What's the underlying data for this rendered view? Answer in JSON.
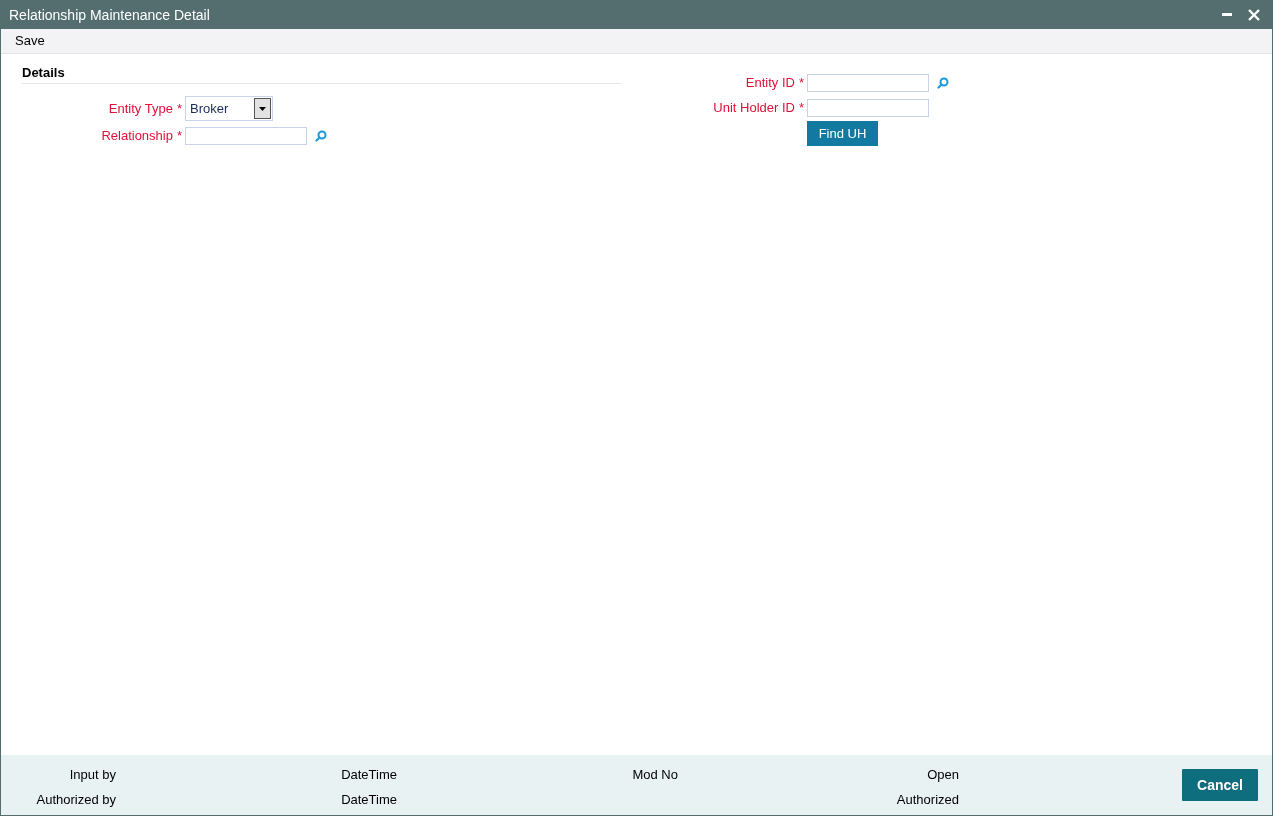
{
  "window": {
    "title": "Relationship Maintenance Detail"
  },
  "toolbar": [
    "Save"
  ],
  "section": {
    "title": "Details"
  },
  "left_fields": [
    {
      "label": "Entity Type",
      "marker": "*",
      "kind": "select",
      "value": "Broker"
    },
    {
      "label": "Relationship",
      "marker": "*",
      "kind": "lookup"
    }
  ],
  "right_fields": [
    {
      "label": "Entity ID",
      "marker": "*",
      "kind": "lookup"
    },
    {
      "label": "Unit Holder ID",
      "marker": "*",
      "kind": "text"
    }
  ],
  "find_button": "Find UH",
  "footer": {
    "columns": [
      [
        "Input by",
        "Authorized by"
      ],
      [
        "DateTime",
        "DateTime"
      ],
      [
        "Mod No"
      ],
      [
        "Open",
        "Authorized"
      ]
    ],
    "cancel": "Cancel"
  }
}
